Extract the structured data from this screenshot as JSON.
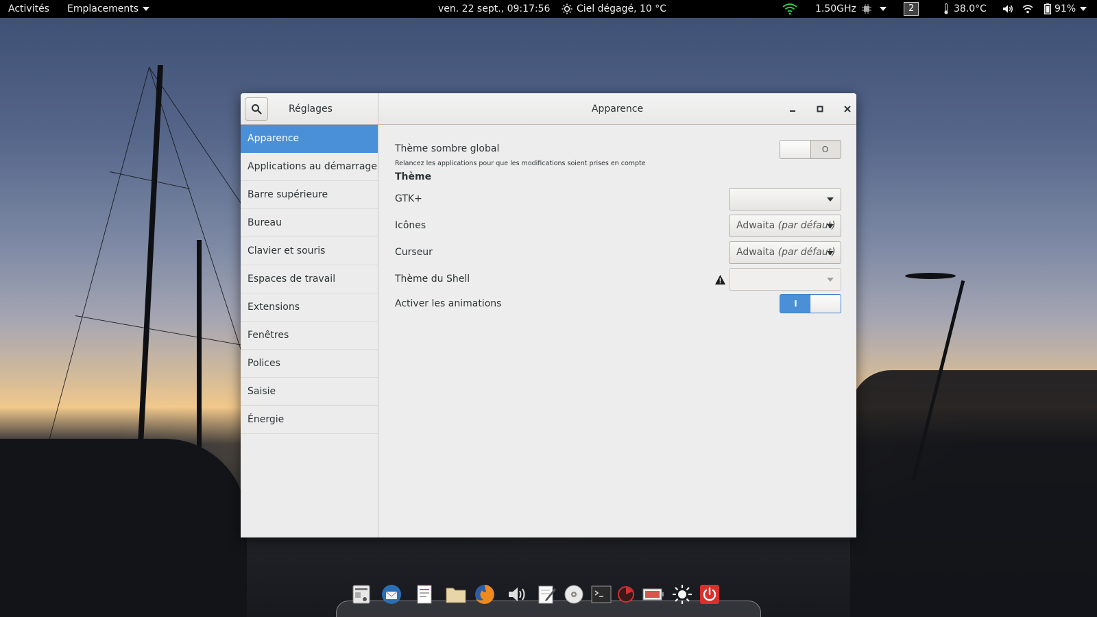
{
  "topbar": {
    "activities": "Activités",
    "places": "Emplacements",
    "datetime": "ven. 22 sept., 09:17:56",
    "weather": "Ciel dégagé, 10 °C",
    "cpu_freq": "1.50GHz",
    "workspace": "2",
    "temperature": "38.0°C",
    "battery": "91%"
  },
  "window": {
    "left_title": "Réglages",
    "title": "Apparence",
    "accent": "#4a90d9"
  },
  "sidebar": {
    "items": [
      {
        "label": "Apparence",
        "active": true
      },
      {
        "label": "Applications au démarrage"
      },
      {
        "label": "Barre supérieure"
      },
      {
        "label": "Bureau"
      },
      {
        "label": "Clavier et souris"
      },
      {
        "label": "Espaces de travail"
      },
      {
        "label": "Extensions"
      },
      {
        "label": "Fenêtres"
      },
      {
        "label": "Polices"
      },
      {
        "label": "Saisie"
      },
      {
        "label": "Énergie"
      }
    ]
  },
  "content": {
    "dark_theme": {
      "label": "Thème sombre global",
      "note": "Relancez les applications pour que les modifications soient prises en compte",
      "switch_off_glyph": "O",
      "state": "off"
    },
    "section_theme": "Thème",
    "gtk": {
      "label": "GTK+",
      "value": ""
    },
    "icons": {
      "label": "Icônes",
      "value_name": "Adwaita",
      "value_suffix": "(par défaut)"
    },
    "cursor": {
      "label": "Curseur",
      "value_name": "Adwaita",
      "value_suffix": "(par défaut)"
    },
    "shell": {
      "label": "Thème du Shell",
      "value": ""
    },
    "animations": {
      "label": "Activer les animations",
      "switch_on_glyph": "I",
      "state": "on"
    }
  },
  "dock": {
    "icons": [
      "system-monitor-icon",
      "thunderbird-icon",
      "text-viewer-icon",
      "files-icon",
      "firefox-icon",
      "volume-icon",
      "text-editor-icon",
      "disc-icon",
      "terminal-icon",
      "disk-usage-icon",
      "battery-app-icon",
      "brightness-icon",
      "power-icon"
    ]
  }
}
